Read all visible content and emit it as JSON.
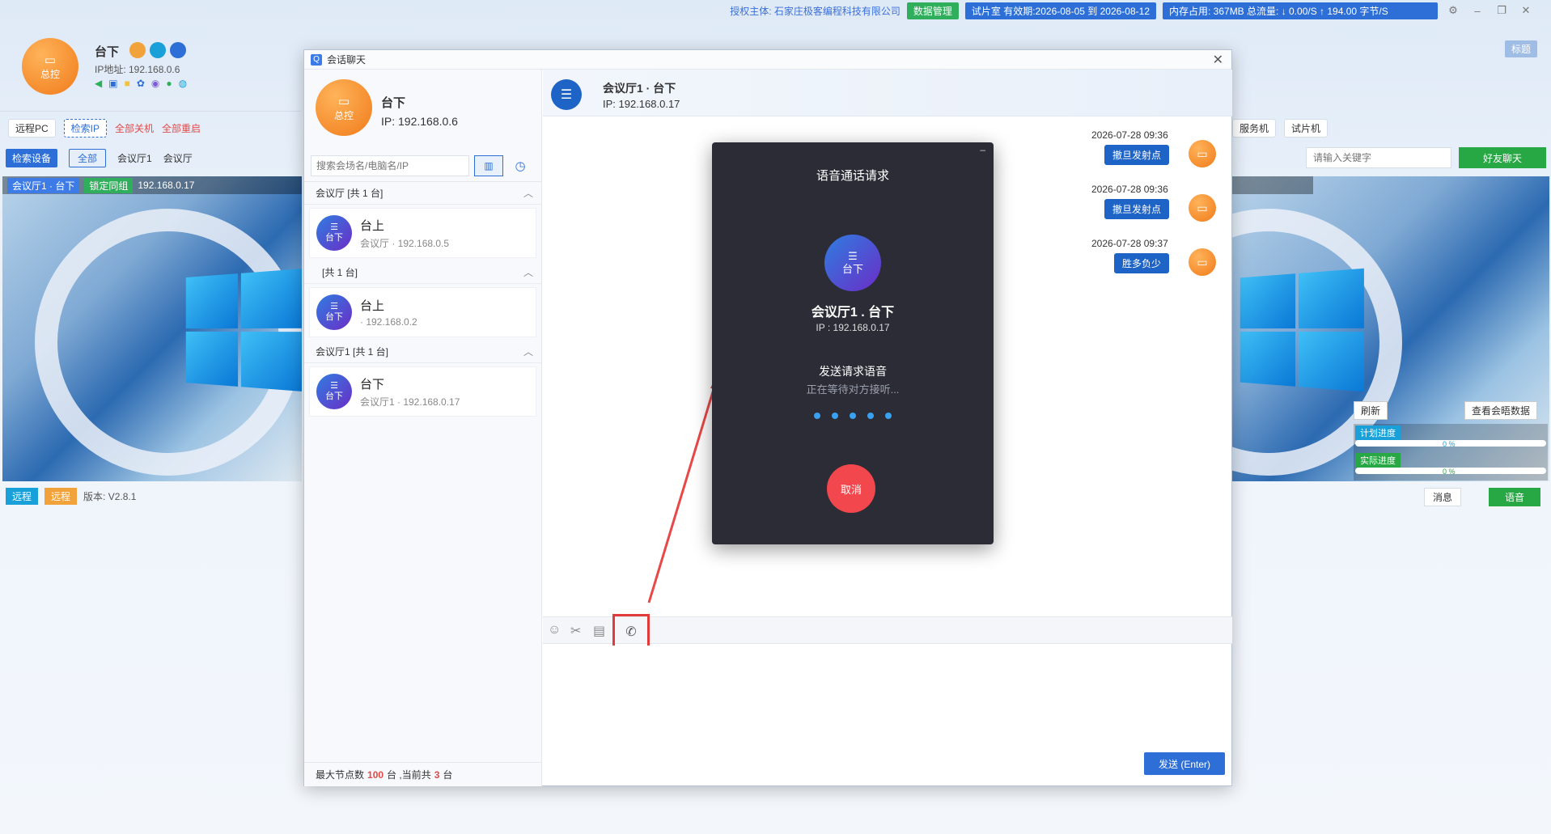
{
  "topbar": {
    "license": "授权主体: 石家庄极客编程科技有限公司",
    "data_mgmt": "数据管理",
    "trial": "试片室 有效期:2026-08-05 到 2026-08-12",
    "stats": "内存占用: 367MB   总流量: ↓ 0.00/S   ↑ 194.00 字节/S"
  },
  "main": {
    "avatar_label": "总控",
    "name": "台下",
    "ip": "IP地址: 192.168.0.6",
    "toolbar": [
      "远程PC",
      "检索IP",
      "全部关机",
      "全部重启"
    ],
    "search_btn": "检索设备",
    "filters": [
      "全部",
      "会议厅1",
      "会议厅"
    ],
    "thumb_title": "会议厅1 · 台下",
    "thumb_badge": "锁定同组",
    "thumb_ip": "192.168.0.17",
    "bottom": {
      "remote1": "远程",
      "remote2": "远程",
      "version": "版本: V2.8.1"
    }
  },
  "right": {
    "skin": "标题",
    "tabs": [
      "服务机",
      "试片机"
    ],
    "search_placeholder": "请输入关键字",
    "friend_chat": "好友聊天",
    "refresh": "刷新",
    "view_data": "查看会晤数据",
    "plan_progress": "计划进度",
    "actual_progress": "实际进度",
    "plan_pct": "0 %",
    "actual_pct": "0 %",
    "msg": "消息",
    "voice": "语音"
  },
  "dialog": {
    "title": "会话聊天",
    "self_avatar": "总控",
    "self_name": "台下",
    "self_ip": "IP:   192.168.0.6",
    "search_placeholder": "搜索会场名/电脑名/IP",
    "groups": [
      {
        "header": "会议厅   [共 1 台]",
        "name": "台上",
        "sub": "会议厅 · 192.168.0.5"
      },
      {
        "header": "[共 1 台]",
        "name": "台上",
        "sub": " · 192.168.0.2"
      },
      {
        "header": "会议厅1   [共 1 台]",
        "name": "台下",
        "sub": "会议厅1 · 192.168.0.17"
      }
    ],
    "dev_avatar": "台下",
    "footer": {
      "prefix": "最大节点数",
      "max": "100",
      "mid": "台 ,当前共",
      "count": "3",
      "suffix": "台"
    },
    "chat_title": "会议厅1  ·  台下",
    "chat_ip": "IP:    192.168.0.17",
    "messages": [
      {
        "time": "2026-07-28 09:36",
        "text": "撤旦发射点"
      },
      {
        "time": "2026-07-28 09:36",
        "text": "撤旦发射点"
      },
      {
        "time": "2026-07-28 09:37",
        "text": "胜多负少"
      }
    ],
    "send": "发送 (Enter)"
  },
  "call": {
    "title": "语音通话请求",
    "avatar": "台下",
    "name": "会议厅1 . 台下",
    "ip": "IP : 192.168.0.17",
    "status": "发送请求语音",
    "waiting": "正在等待对方接听...",
    "cancel": "取消"
  },
  "colors": {
    "accent": "#1e63c6",
    "orange": "#f07b1a",
    "red": "#f2474d",
    "green": "#28a745"
  }
}
